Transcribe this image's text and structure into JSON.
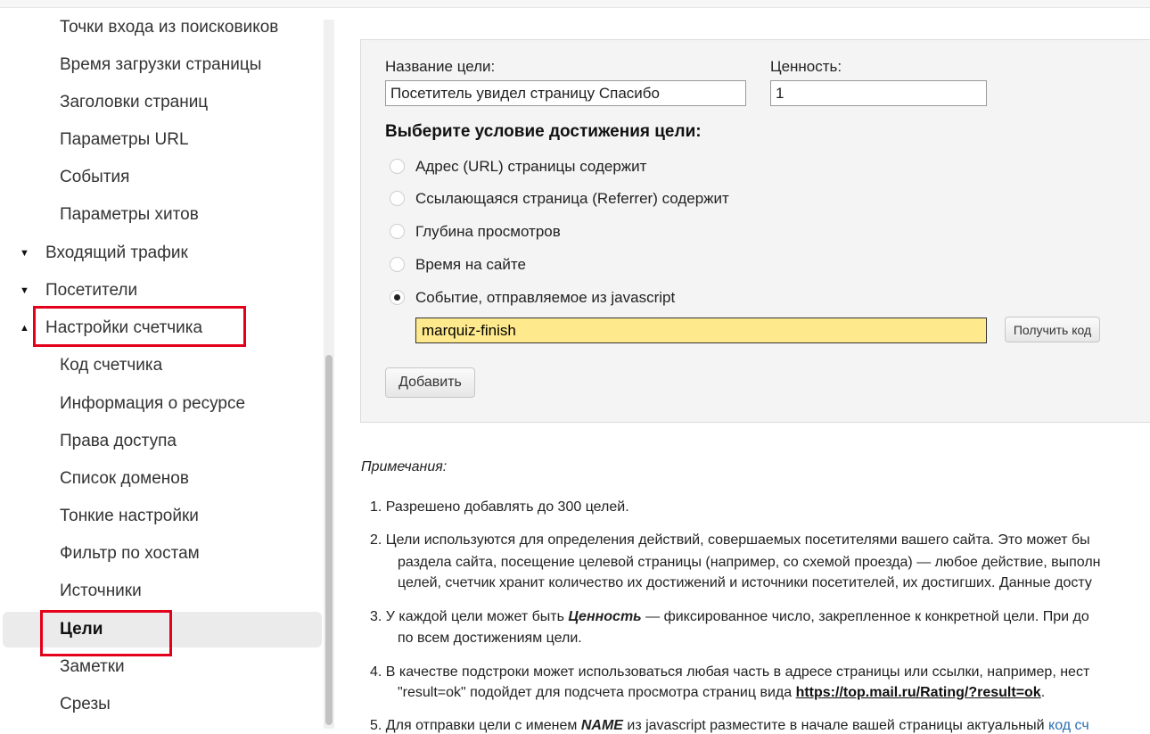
{
  "sidebar": {
    "items_top": [
      "Точки входа из поисковиков",
      "Время загрузки страницы",
      "Заголовки страниц",
      "Параметры URL",
      "События",
      "Параметры хитов"
    ],
    "group_incoming": "Входящий трафик",
    "group_visitors": "Посетители",
    "group_settings": "Настройки счетчика",
    "items_settings": [
      "Код счетчика",
      "Информация о ресурсе",
      "Права доступа",
      "Список доменов",
      "Тонкие настройки",
      "Фильтр по хостам",
      "Источники",
      "Цели",
      "Заметки",
      "Срезы"
    ]
  },
  "form": {
    "goal_name_label": "Название цели:",
    "goal_name_value": "Посетитель увидел страницу Спасибо",
    "value_label": "Ценность:",
    "value_value": "1",
    "condition_title": "Выберите условие достижения цели:",
    "conditions": [
      "Адрес (URL) страницы содержит",
      "Ссылающаяся страница (Referrer) содержит",
      "Глубина просмотров",
      "Время на сайте",
      "Событие, отправляемое из javascript"
    ],
    "selected_condition": "Событие, отправляемое из javascript",
    "event_value": "marquiz-finish",
    "get_code_button": "Получить код",
    "add_button": "Добавить"
  },
  "notes": {
    "title": "Примечания:",
    "n1": "1.  Разрешено добавлять до 300 целей.",
    "n2_l1": "2.  Цели используются для определения действий, совершаемых посетителями вашего сайта. Это может бы",
    "n2_l2": "раздела сайта, посещение целевой страницы (например, со схемой проезда) — любое действие, выполн",
    "n2_l3": "целей, счетчик хранит количество их достижений и источники посетителей, их достигших. Данные досту",
    "n3_pre": "3.   У каждой цели может быть ",
    "n3_bold": "Ценность",
    "n3_post": " — фиксированное число, закрепленное к конкретной цели. При до",
    "n3_l2": "по всем достижениям цели.",
    "n4_l1": "4.   В качестве подстроки может использоваться любая часть в адресе страницы или ссылки, например, нест",
    "n4_pre": "\"result=ok\" подойдет для подсчета просмотра страниц вида ",
    "n4_link": "https://top.mail.ru/Rating/?result=ok",
    "n4_post": ".",
    "n5_pre": "5.   Для отправки цели с именем ",
    "n5_bold": "NAME",
    "n5_mid": " из javascript разместите в начале вашей страницы актуальный ",
    "n5_link": "код сч"
  },
  "colors": {
    "highlight_box": "#e3001b",
    "event_field_bg": "#fee98c",
    "link": "#2a6db0"
  }
}
